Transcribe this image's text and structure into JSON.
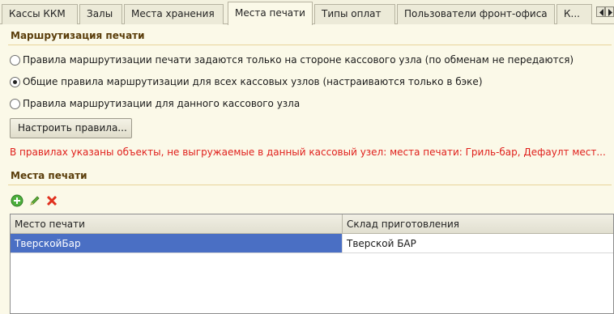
{
  "tabs": [
    {
      "label": "Кассы ККМ"
    },
    {
      "label": "Залы"
    },
    {
      "label": "Места хранения"
    },
    {
      "label": "Места печати"
    },
    {
      "label": "Типы оплат"
    },
    {
      "label": "Пользователи фронт-офиса"
    },
    {
      "label": "К..."
    }
  ],
  "active_tab": "Места печати",
  "routing": {
    "title": "Маршрутизация печати",
    "options": [
      {
        "label": "Правила маршрутизации печати задаются только на стороне кассового узла (по обменам не передаются)",
        "checked": false
      },
      {
        "label": "Общие правила маршрутизации для всех кассовых узлов (настраиваются только в бэке)",
        "checked": true
      },
      {
        "label": "Правила маршрутизации для данного кассового узла",
        "checked": false
      }
    ],
    "configure_button": "Настроить правила...",
    "warning": "В правилах указаны объекты, не выгружаемые в данный кассовый узел: места печати: Гриль-бар, Дефаулт мест..."
  },
  "print_places": {
    "title": "Места печати",
    "toolbar": [
      "add-icon",
      "edit-icon",
      "delete-icon"
    ],
    "columns": [
      "Место печати",
      "Склад приготовления"
    ],
    "rows": [
      {
        "place": "ТверскойБар",
        "warehouse": "Тверской БАР",
        "selected": true
      }
    ]
  },
  "colors": {
    "accent_header": "#5a3d0a",
    "warning_text": "#e0201c",
    "selection": "#4a6fc4",
    "background": "#fbf9e8"
  }
}
